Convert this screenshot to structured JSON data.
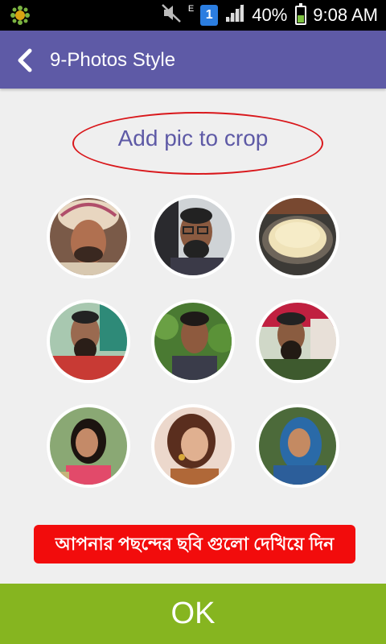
{
  "status_bar": {
    "battery": "40%",
    "time": "9:08 AM",
    "sim_slot": "1",
    "network_type": "E",
    "icons": [
      "app-notification-icon",
      "mute-icon",
      "sim-icon",
      "signal-icon",
      "battery-icon"
    ]
  },
  "app_bar": {
    "title": "9-Photos Style",
    "back_icon": "chevron-left-icon"
  },
  "crop_label": "Add pic to crop",
  "photos": [
    {
      "desc": "man-with-turban"
    },
    {
      "desc": "man-with-glasses"
    },
    {
      "desc": "food-bread"
    },
    {
      "desc": "man-with-beard-red"
    },
    {
      "desc": "man-with-plants"
    },
    {
      "desc": "man-with-beard-green"
    },
    {
      "desc": "girl-outdoor"
    },
    {
      "desc": "woman-with-earrings"
    },
    {
      "desc": "woman-in-blue-scarf"
    }
  ],
  "instruction": "আপনার পছন্দের ছবি গুলো দেখিয়ে দিন",
  "ok_label": "OK",
  "colors": {
    "app_bar": "#5e5aa6",
    "ok_button": "#86b520",
    "instruction_bg": "#f20c0c",
    "ellipse": "#d9171b"
  }
}
